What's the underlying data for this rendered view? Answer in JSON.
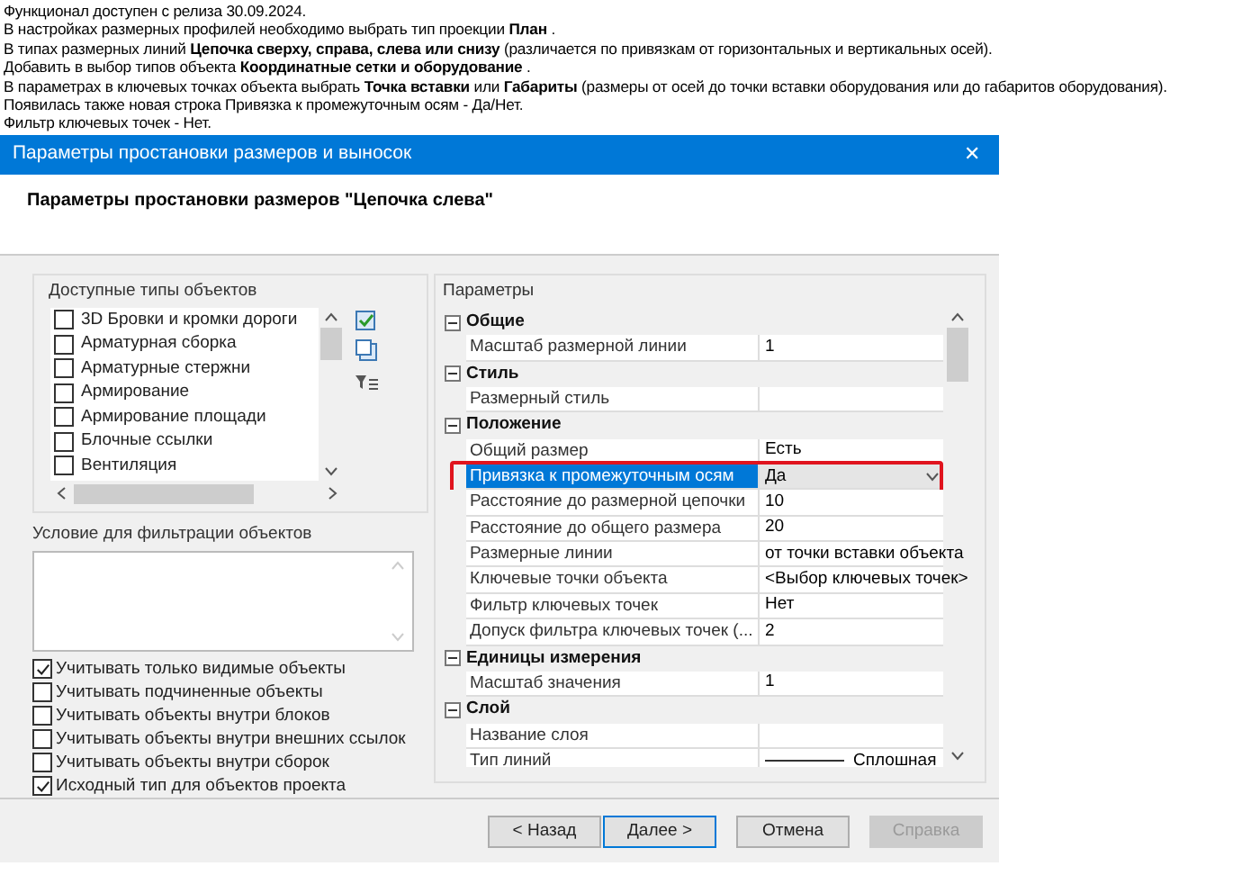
{
  "intro": [
    "Функционал доступен с релиза 30.09.2024.",
    "В настройках размерных профилей необходимо выбрать тип проекции **План** .",
    "В типах размерных линий **Цепочка сверху, справа, слева или снизу** (различается по привязкам от горизонтальных и вертикальных осей).",
    "Добавить в выбор типов объекта **Координатные сетки и оборудование** .",
    "В параметрах в ключевых точках объекта выбрать **Точка вставки** или **Габариты** (размеры от осей до точки вставки оборудования или до габаритов оборудования).",
    "Появилась также новая строка Привязка к промежуточным осям - Да/Нет.",
    "Фильтр ключевых точек - Нет."
  ],
  "dialog": {
    "title": "Параметры простановки размеров и выносок",
    "close": "✕",
    "heading": "Параметры простановки размеров \"Цепочка слева\"",
    "object_types": {
      "label": "Доступные типы объектов",
      "items": [
        {
          "label": "3D Бровки и кромки дороги",
          "checked": false
        },
        {
          "label": "Арматурная сборка",
          "checked": false
        },
        {
          "label": "Арматурные стержни",
          "checked": false
        },
        {
          "label": "Армирование",
          "checked": false
        },
        {
          "label": "Армирование площади",
          "checked": false
        },
        {
          "label": "Блочные ссылки",
          "checked": false
        },
        {
          "label": "Вентиляция",
          "checked": false
        }
      ]
    },
    "filter": {
      "label": "Условие для фильтрации объектов"
    },
    "options": [
      {
        "label": "Учитывать только видимые объекты",
        "checked": true
      },
      {
        "label": "Учитывать подчиненные объекты",
        "checked": false
      },
      {
        "label": "Учитывать объекты внутри блоков",
        "checked": false
      },
      {
        "label": "Учитывать объекты внутри внешних ссылок",
        "checked": false
      },
      {
        "label": "Учитывать объекты внутри сборок",
        "checked": false
      },
      {
        "label": "Исходный тип для объектов проекта",
        "checked": true
      }
    ],
    "params": {
      "label": "Параметры",
      "groups": [
        {
          "title": "Общие",
          "expanded": true,
          "rows": [
            {
              "name": "Масштаб размерной линии",
              "value": "1",
              "kind": "text",
              "selected": false
            }
          ]
        },
        {
          "title": "Стиль",
          "expanded": true,
          "rows": [
            {
              "name": "Размерный стиль",
              "kind": "text",
              "selected": false
            }
          ]
        },
        {
          "title": "Положение",
          "expanded": true,
          "rows": [
            {
              "name": "Общий размер",
              "value": "Есть",
              "kind": "text",
              "selected": false
            },
            {
              "name": "Привязка к промежуточным осям",
              "value": "Да",
              "kind": "dropdown",
              "selected": true,
              "highlighted": true
            },
            {
              "name": "Расстояние до размерной цепочки",
              "value": "10",
              "kind": "text",
              "selected": false
            },
            {
              "name": "Расстояние до общего размера",
              "value": "20",
              "kind": "text",
              "selected": false
            },
            {
              "name": "Размерные линии",
              "value": "от точки вставки объекта",
              "kind": "text",
              "selected": false
            },
            {
              "name": "Ключевые точки объекта",
              "value": "<Выбор ключевых точек>",
              "kind": "text",
              "selected": false
            },
            {
              "name": "Фильтр ключевых точек",
              "value": "Нет",
              "kind": "text",
              "selected": false
            },
            {
              "name": "Допуск фильтра ключевых точек (...",
              "value": "2",
              "kind": "text",
              "selected": false
            }
          ]
        },
        {
          "title": "Единицы измерения",
          "expanded": true,
          "rows": [
            {
              "name": "Масштаб значения",
              "value": "1",
              "kind": "text",
              "selected": false
            }
          ]
        },
        {
          "title": "Слой",
          "expanded": true,
          "rows": [
            {
              "name": "Название слоя",
              "kind": "text",
              "selected": false
            },
            {
              "name": "Тип линий",
              "value": "Сплошная",
              "kind": "linetype",
              "selected": false
            }
          ]
        }
      ]
    },
    "buttons": [
      {
        "label": "< Назад",
        "disabled": false,
        "default": false
      },
      {
        "label": "Далее >",
        "disabled": false,
        "default": true
      },
      {
        "label": "Отмена",
        "disabled": false,
        "default": false
      },
      {
        "label": "Справка",
        "disabled": true,
        "default": false
      }
    ]
  }
}
